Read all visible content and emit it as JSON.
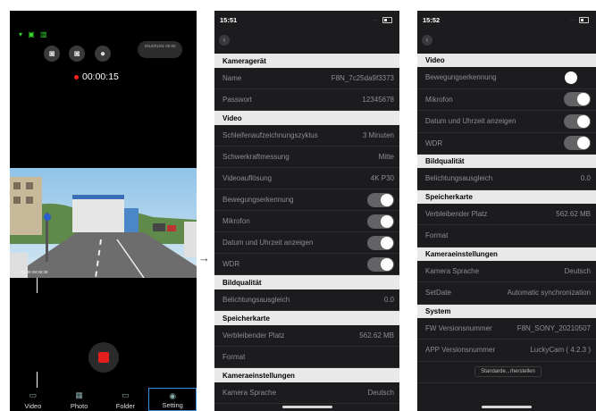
{
  "camera": {
    "status_icons": "▾ ▣ ▥",
    "timestamp_pill": "2019/01/01 00:00",
    "rec_time": "00:00:15",
    "video_timestamp": "FL 25/08 08:38:38",
    "nav": [
      {
        "label": "Video",
        "icon": "video-icon"
      },
      {
        "label": "Photo",
        "icon": "photo-icon"
      },
      {
        "label": "Folder",
        "icon": "folder-icon"
      },
      {
        "label": "Setting",
        "icon": "setting-icon"
      }
    ],
    "colors": {
      "record": "#e32020",
      "active_tab": "#3a90d8",
      "wifi": "#38d430"
    }
  },
  "settings1": {
    "time": "15:51",
    "rows": [
      {
        "type": "header",
        "label": "Kameragerät"
      },
      {
        "type": "value",
        "label": "Name",
        "value": "F8N_7c25da9f3373"
      },
      {
        "type": "value",
        "label": "Passwort",
        "value": "12345678"
      },
      {
        "type": "header",
        "label": "Video"
      },
      {
        "type": "value",
        "label": "Schleifenaufzeichnungszyklus",
        "value": "3 Minuten"
      },
      {
        "type": "value",
        "label": "Schwerkraftmessung",
        "value": "Mitte"
      },
      {
        "type": "value",
        "label": "Videoauflösung",
        "value": "4K P30"
      },
      {
        "type": "toggle",
        "label": "Bewegungserkennung",
        "on": true
      },
      {
        "type": "toggle",
        "label": "Mikrofon",
        "on": true
      },
      {
        "type": "toggle",
        "label": "Datum und Uhrzeit anzeigen",
        "on": true
      },
      {
        "type": "toggle",
        "label": "WDR",
        "on": true
      },
      {
        "type": "header",
        "label": "Bildqualität"
      },
      {
        "type": "value",
        "label": "Belichtungsausgleich",
        "value": "0.0"
      },
      {
        "type": "header",
        "label": "Speicherkarte"
      },
      {
        "type": "value",
        "label": "Verbleibender Platz",
        "value": "562.62 MB"
      },
      {
        "type": "value",
        "label": "Format",
        "value": ""
      },
      {
        "type": "header",
        "label": "Kameraeinstellungen"
      },
      {
        "type": "value",
        "label": "Kamera Sprache",
        "value": "Deutsch"
      }
    ]
  },
  "settings2": {
    "time": "15:52",
    "rows": [
      {
        "type": "header",
        "label": "Video"
      },
      {
        "type": "toggle",
        "label": "Bewegungserkennung",
        "on": false
      },
      {
        "type": "toggle",
        "label": "Mikrofon",
        "on": true
      },
      {
        "type": "toggle",
        "label": "Datum und Uhrzeit anzeigen",
        "on": true
      },
      {
        "type": "toggle",
        "label": "WDR",
        "on": true
      },
      {
        "type": "header",
        "label": "Bildqualität"
      },
      {
        "type": "value",
        "label": "Belichtungsausgleich",
        "value": "0.0"
      },
      {
        "type": "header",
        "label": "Speicherkarte"
      },
      {
        "type": "value",
        "label": "Verbleibender Platz",
        "value": "562.62 MB"
      },
      {
        "type": "value",
        "label": "Format",
        "value": ""
      },
      {
        "type": "header",
        "label": "Kameraeinstellungen"
      },
      {
        "type": "value",
        "label": "Kamera Sprache",
        "value": "Deutsch"
      },
      {
        "type": "value",
        "label": "SetDate",
        "value": "Automatic synchronization"
      },
      {
        "type": "header",
        "label": "System"
      },
      {
        "type": "value",
        "label": "FW Versionsnummer",
        "value": "F8N_SONY_20210507"
      },
      {
        "type": "value",
        "label": "APP Versionsnummer",
        "value": "LuckyCam ( 4.2.3 )"
      },
      {
        "type": "button",
        "label": "Standarde...rherstellen"
      }
    ]
  }
}
